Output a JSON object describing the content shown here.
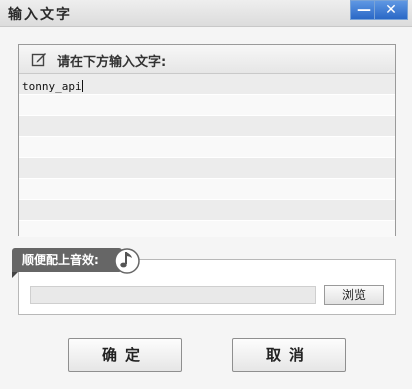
{
  "window": {
    "title": "输入文字",
    "minimize_glyph": "—",
    "close_glyph": "✕"
  },
  "text_panel": {
    "label": "请在下方输入文字:",
    "icon": "edit-icon",
    "content": "tonny_api"
  },
  "sound_panel": {
    "label": "顺便配上音效:",
    "icon": "music-note-icon",
    "file_value": "",
    "browse_label": "浏览"
  },
  "buttons": {
    "ok_label": "确定",
    "cancel_label": "取消"
  },
  "colors": {
    "title_bar_button": "#2a68c6",
    "tag_background": "#666666"
  }
}
